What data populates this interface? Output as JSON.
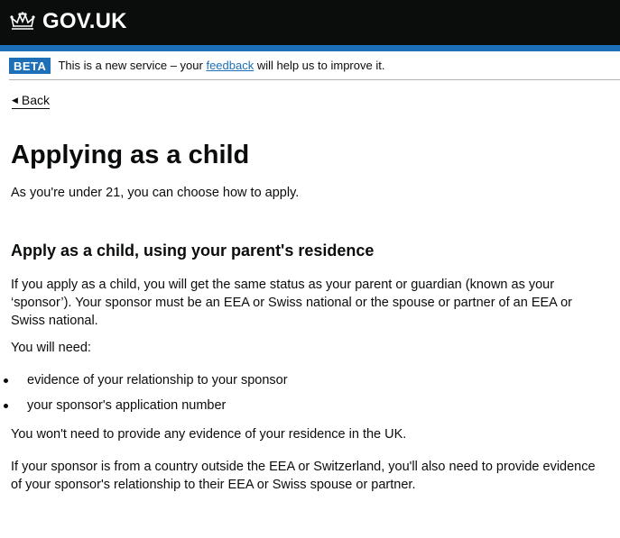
{
  "header": {
    "logo_text": "GOV.UK"
  },
  "phase_banner": {
    "tag": "BETA",
    "text_before": "This is a new service – your ",
    "link": "feedback",
    "text_after": " will help us to improve it."
  },
  "back_link": {
    "label": "Back"
  },
  "main": {
    "title": "Applying as a child",
    "lead": "As you're under 21, you can choose how to apply.",
    "section_heading": "Apply as a child, using your parent's residence",
    "para1": "If you apply as a child, you will get the same status as your parent or guardian (known as your ‘sponsor’). Your sponsor must be an EEA or Swiss national or the spouse or partner of an EEA or Swiss national.",
    "need_intro": "You will need:",
    "needs": [
      "evidence of your relationship to your sponsor",
      "your sponsor's application number"
    ],
    "para2": "You won't need to provide any evidence of your residence in the UK.",
    "para3": "If your sponsor is from a country outside the EEA or Switzerland, you'll also need to provide evidence of your sponsor's relationship to their EEA or Swiss spouse or partner."
  },
  "colors": {
    "header_bg": "#0b0c0c",
    "brand_blue": "#1d70b8",
    "text": "#0b0c0c"
  }
}
